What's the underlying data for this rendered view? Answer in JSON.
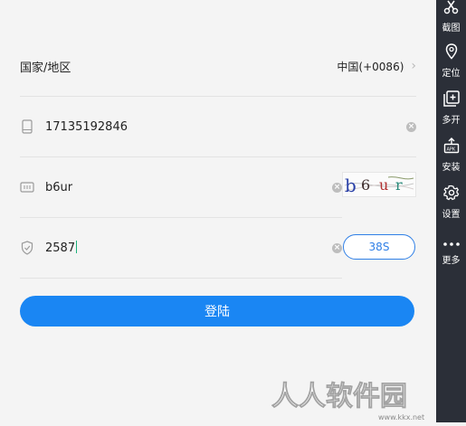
{
  "region": {
    "label": "国家/地区",
    "value": "中国(+0086)"
  },
  "phone": {
    "value": "17135192846"
  },
  "captcha": {
    "value": "b6ur",
    "image_text": "b6ur"
  },
  "sms": {
    "value": "2587",
    "countdown": "38S"
  },
  "login": {
    "label": "登陆"
  },
  "sidebar": {
    "items": [
      {
        "label": "截图",
        "icon": "scissors-icon"
      },
      {
        "label": "定位",
        "icon": "location-pin-icon"
      },
      {
        "label": "多开",
        "icon": "multi-open-icon"
      },
      {
        "label": "安装",
        "icon": "apk-install-icon"
      },
      {
        "label": "设置",
        "icon": "gear-icon"
      },
      {
        "label": "更多",
        "icon": "more-dots-icon"
      }
    ]
  },
  "watermark": {
    "text": "人人软件园",
    "url": "www.kkx.net"
  },
  "colors": {
    "primary": "#1a86f3",
    "sidebar_bg": "#2b2f38",
    "page_bg": "#f4f4f4"
  }
}
